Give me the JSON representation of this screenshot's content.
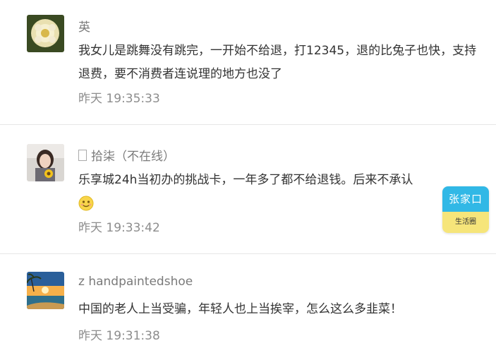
{
  "comments": [
    {
      "author": "英",
      "text": "我女儿是跳舞没有跳完，一开始不给退，打12345，退的比兔子也快，支持退费，要不消费者连说理的地方也没了",
      "time": "昨天 19:35:33",
      "avatar_icon": "flower-avatar"
    },
    {
      "author": "拾柒（不在线）",
      "text": "乐享城24h当初办的挑战卡，一年多了都不给退钱。后来不承认",
      "emoji": "smile-emoji",
      "time": "昨天 19:33:42",
      "avatar_icon": "girl-with-sunflower-avatar"
    },
    {
      "author": "z handpaintedshoe",
      "text": "中国的老人上当受骗，年轻人也上当挨宰，怎么这么多韭菜！",
      "time": "昨天 19:31:38",
      "avatar_icon": "sunset-beach-avatar"
    }
  ],
  "badge": {
    "title": "张家口",
    "subtitle": "生活圈"
  }
}
